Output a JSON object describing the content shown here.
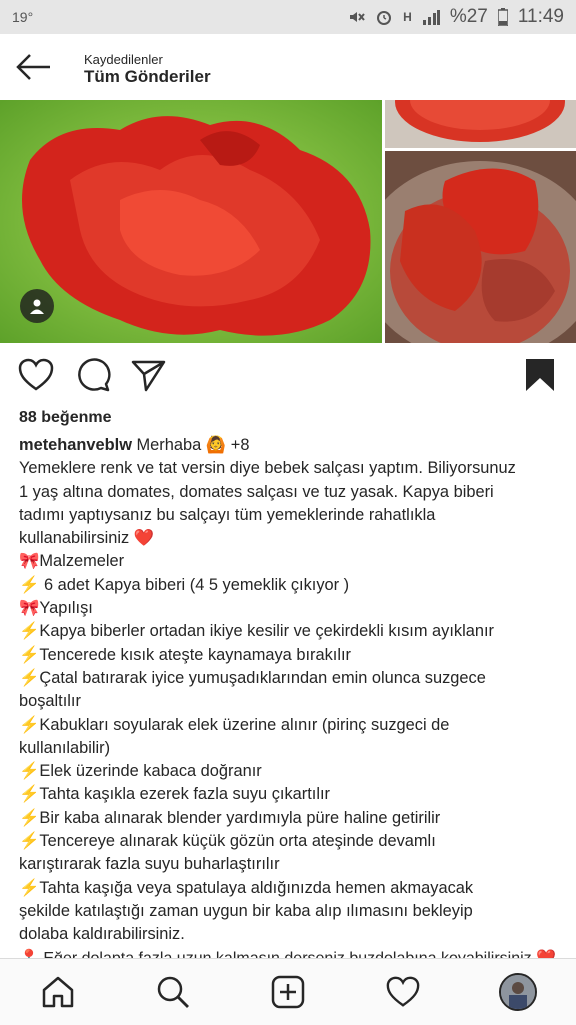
{
  "status_bar": {
    "temp": "19°",
    "battery": "%27",
    "time": "11:49",
    "icons": [
      "mute-icon",
      "alarm-icon",
      "data-h-icon",
      "signal-icon",
      "battery-icon"
    ]
  },
  "header": {
    "subtitle": "Kaydedilenler",
    "title": "Tüm Gönderiler",
    "back_icon": "arrow-left-icon"
  },
  "post": {
    "likes": "88 beğenme",
    "username": "metehanveblw",
    "greeting": "Merhaba",
    "greeting_emoji": "🙆",
    "tag_count": "+8",
    "lines": [
      "Yemeklere renk ve tat versin diye bebek salçası yaptım. Biliyorsunuz",
      "1 yaş altına domates, domates salçası ve tuz yasak. Kapya biberi",
      "tadımı yaptıysanız bu salçayı tüm yemeklerinde rahatlıkla",
      "kullanabilirsiniz ❤️",
      "🎀Malzemeler",
      "⚡ 6 adet Kapya biberi (4 5 yemeklik çıkıyor )",
      "🎀Yapılışı",
      "⚡Kapya biberler ortadan ikiye kesilir ve çekirdekli kısım ayıklanır",
      "⚡Tencerede kısık ateşte kaynamaya bırakılır",
      "⚡Çatal batırarak iyice yumuşadıklarından emin olunca suzgece",
      "boşaltılır",
      "⚡Kabukları soyularak elek üzerine alınır (pirinç suzgeci de",
      "kullanılabilir)",
      "⚡Elek üzerinde kabaca doğranır",
      "⚡Tahta kaşıkla ezerek fazla suyu çıkartılır",
      "⚡Bir kaba alınarak blender yardımıyla püre haline getirilir",
      "⚡Tencereye alınarak küçük gözün orta ateşinde devamlı",
      "karıştırarak fazla suyu buharlaştırılır",
      "⚡Tahta kaşığa veya spatulaya aldığınızda hemen akmayacak",
      "şekilde katılaştığı zaman uygun bir kaba alıp ılımasını bekleyip",
      "dolaba kaldırabilirsiniz."
    ],
    "cut_line": "📍 Eğer dolapta fazla uzun kalmasın derseniz buzdolabına koyabilirsiniz ❤️"
  },
  "icons": {
    "like": "heart-icon",
    "comment": "comment-icon",
    "share": "send-icon",
    "save": "bookmark-icon"
  },
  "nav": [
    "home-icon",
    "search-icon",
    "add-icon",
    "activity-heart-icon",
    "profile-avatar"
  ]
}
